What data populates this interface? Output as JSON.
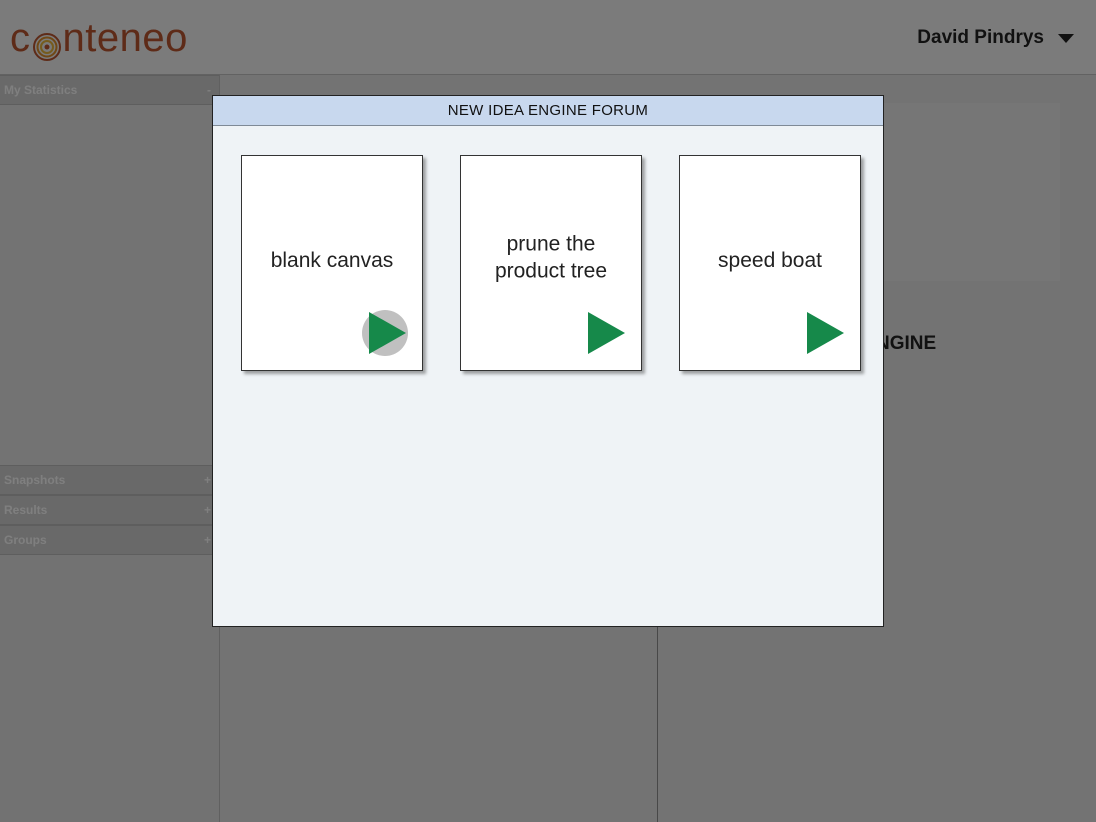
{
  "header": {
    "logo_text": "conteneo",
    "user_name": "David Pindrys",
    "logo_color": "#b4542e"
  },
  "sidebar": {
    "sections": [
      {
        "label": "My Statistics",
        "toggle": "-"
      },
      {
        "label": "Snapshots",
        "toggle": "+"
      },
      {
        "label": "Results",
        "toggle": "+"
      },
      {
        "label": "Groups",
        "toggle": "+"
      }
    ]
  },
  "background": {
    "engine_label": "NGINE"
  },
  "modal": {
    "title": "NEW IDEA ENGINE FORUM",
    "cards": [
      {
        "label": "blank canvas",
        "icon": "play-icon",
        "hovered": true
      },
      {
        "label": "prune the\nproduct tree",
        "icon": "play-icon",
        "hovered": false
      },
      {
        "label": "speed boat",
        "icon": "play-icon",
        "hovered": false
      }
    ]
  },
  "colors": {
    "play_green": "#16894a",
    "modal_title_bg": "#c8d8ee",
    "modal_body_bg": "#eff3f6"
  }
}
